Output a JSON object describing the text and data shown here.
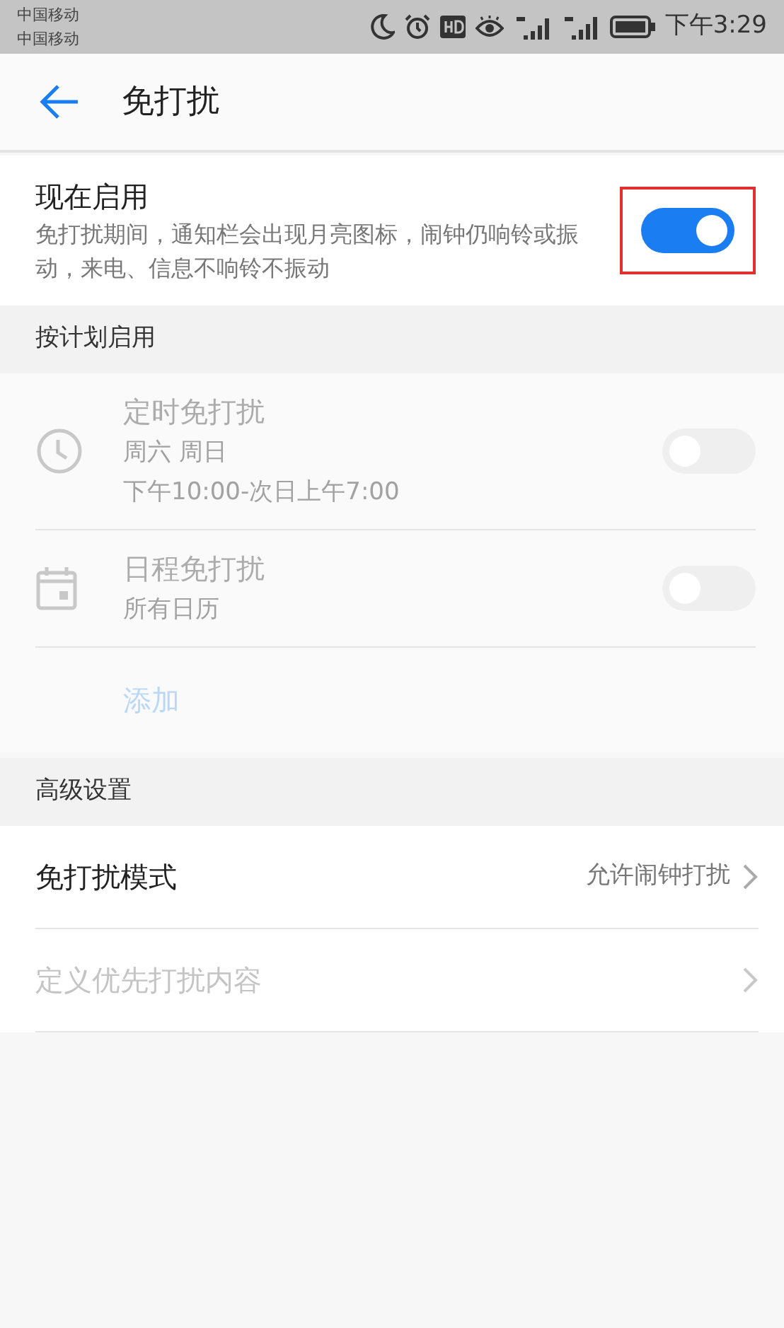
{
  "status_bar": {
    "carriers": [
      "中国移动",
      "中国移动"
    ],
    "time": "下午3:29"
  },
  "app_bar": {
    "title": "免打扰"
  },
  "now_section": {
    "title": "现在启用",
    "description": "免打扰期间，通知栏会出现月亮图标，闹钟仍响铃或振动，来电、信息不响铃不振动",
    "on": true,
    "highlighted": true
  },
  "schedule_section": {
    "header": "按计划启用",
    "disabled": true,
    "items": [
      {
        "kind": "clock",
        "title": "定时免打扰",
        "lines": [
          "周六 周日",
          "下午10:00-次日上午7:00"
        ],
        "on": false
      },
      {
        "kind": "calendar",
        "title": "日程免打扰",
        "lines": [
          "所有日历"
        ],
        "on": false
      }
    ],
    "add_label": "添加"
  },
  "advanced_section": {
    "header": "高级设置",
    "items": [
      {
        "title": "免打扰模式",
        "value": "允许闹钟打扰",
        "disabled": false
      },
      {
        "title": "定义优先打扰内容",
        "disabled": true
      }
    ]
  }
}
